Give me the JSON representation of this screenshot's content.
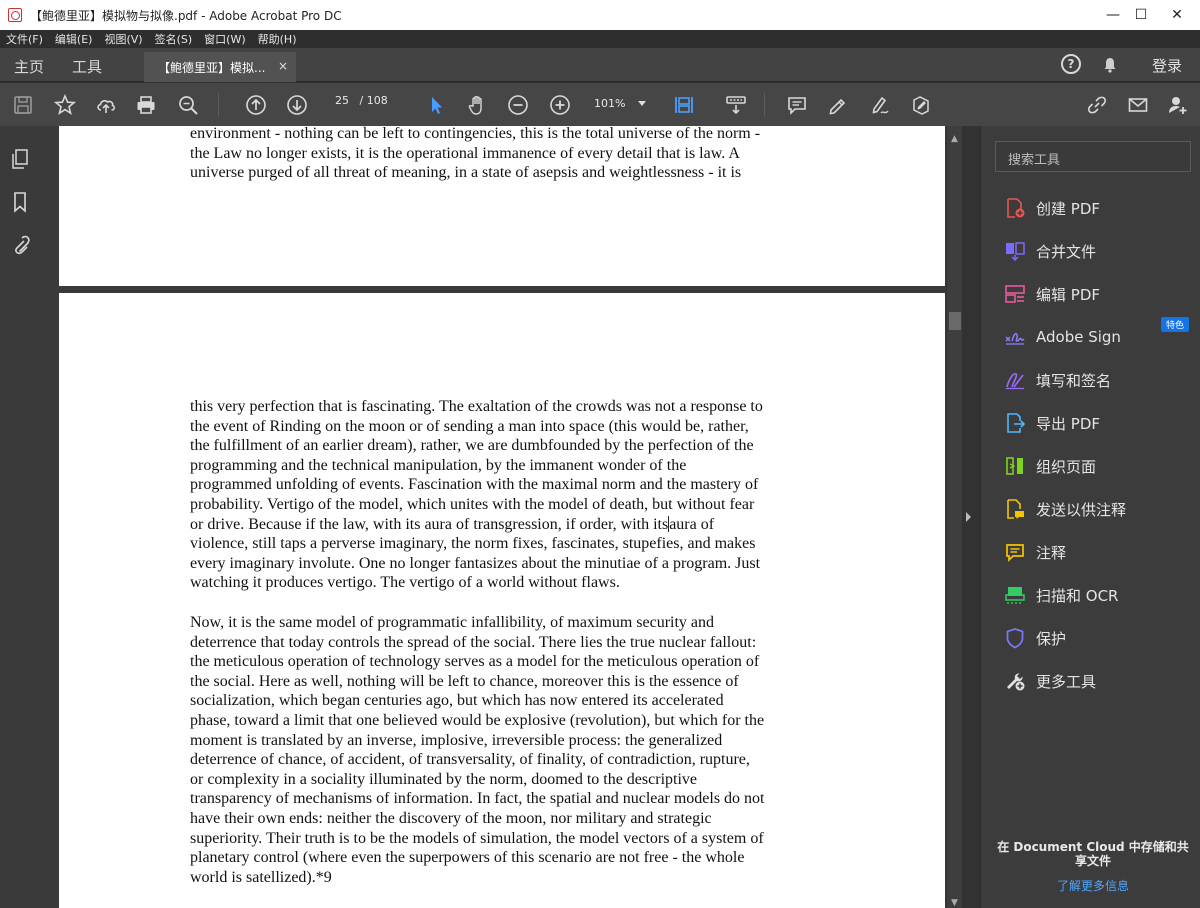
{
  "window": {
    "title": "【鲍德里亚】模拟物与拟像.pdf - Adobe Acrobat Pro DC",
    "minimize": "—",
    "maximize": "☐",
    "close": "✕"
  },
  "menu": [
    "文件(F)",
    "编辑(E)",
    "视图(V)",
    "签名(S)",
    "窗口(W)",
    "帮助(H)"
  ],
  "tabs": {
    "home": "主页",
    "tools": "工具",
    "document": "【鲍德里亚】模拟...",
    "close": "×",
    "help": "?",
    "login": "登录"
  },
  "toolbar": {
    "current_page": "25",
    "total_pages": "/ 108",
    "zoom": "101%"
  },
  "document": {
    "page1_lines": [
      "environment - nothing can be left to contingencies, this is the total universe of the norm -",
      "the Law no longer exists, it is the operational immanence of every detail that is law. A",
      "universe purged of all threat of meaning, in a state of asepsis and weightlessness - it is"
    ],
    "para1_lines": [
      "this very perfection that is fascinating. The exaltation of the crowds was not a response to",
      "the event of Rinding on the moon or of sending a man into space (this would be, rather,",
      "the fulfillment of an earlier dream), rather, we are dumbfounded by the perfection of the",
      "programming and the technical manipulation, by the immanent wonder of the",
      "programmed unfolding of events. Fascination with the maximal norm and the mastery of",
      "probability. Vertigo of the model, which unites with the model of death, but without fear",
      "or drive. Because if the law, with its aura of transgression, if order, with its",
      "violence, still taps a perverse imaginary, the norm fixes, fascinates, stupefies, and makes",
      "every imaginary involute. One no longer fantasizes about the minutiae of a program. Just",
      "watching it produces vertigo. The vertigo of a world without flaws."
    ],
    "para1_line7_tail": "aura of",
    "para2_lines": [
      "Now, it is the same model of programmatic infallibility, of maximum security and",
      "deterrence that today controls the spread of the social. There lies the true nuclear fallout:",
      "the meticulous operation of technology serves as a model for the meticulous operation of",
      "the social. Here as well, nothing will be left to chance, moreover this is the essence of",
      "socialization, which began centuries ago, but which has now entered its accelerated",
      "phase, toward a limit that one believed would be explosive (revolution), but which for the",
      "moment is translated by an inverse, implosive, irreversible process: the generalized",
      "deterrence of chance, of accident, of transversality, of finality, of contradiction, rupture,",
      "or complexity in a sociality illuminated by the norm, doomed to the descriptive",
      "transparency of mechanisms of information. In fact, the spatial and nuclear models do not",
      "have their own ends: neither the discovery of the moon, nor military and strategic",
      "superiority. Their truth is to be the models of simulation, the model vectors of a system of",
      "planetary control (where even the superpowers of this scenario are not free - the whole",
      "world is satellized).*9"
    ]
  },
  "tools_pane": {
    "search_placeholder": "搜索工具",
    "badge": "特色",
    "items": [
      {
        "label": "创建 PDF",
        "icon": "create-pdf-icon",
        "color": "#e8554e"
      },
      {
        "label": "合并文件",
        "icon": "combine-files-icon",
        "color": "#7a6bff"
      },
      {
        "label": "编辑 PDF",
        "icon": "edit-pdf-icon",
        "color": "#e85a9a"
      },
      {
        "label": "Adobe Sign",
        "icon": "adobe-sign-icon",
        "color": "#8b7dff"
      },
      {
        "label": "填写和签名",
        "icon": "fill-sign-icon",
        "color": "#9b6bff"
      },
      {
        "label": "导出 PDF",
        "icon": "export-pdf-icon",
        "color": "#4db8ff"
      },
      {
        "label": "组织页面",
        "icon": "organize-pages-icon",
        "color": "#7ed321"
      },
      {
        "label": "发送以供注释",
        "icon": "send-comments-icon",
        "color": "#f5c400"
      },
      {
        "label": "注释",
        "icon": "comment-icon",
        "color": "#f5c400"
      },
      {
        "label": "扫描和 OCR",
        "icon": "scan-ocr-icon",
        "color": "#33cc66"
      },
      {
        "label": "保护",
        "icon": "protect-icon",
        "color": "#7a7aff"
      },
      {
        "label": "更多工具",
        "icon": "more-tools-icon",
        "color": "#e0e0e0"
      }
    ],
    "cloud_text": "在 Document Cloud 中存储和共享文件",
    "learn_more": "了解更多信息"
  }
}
